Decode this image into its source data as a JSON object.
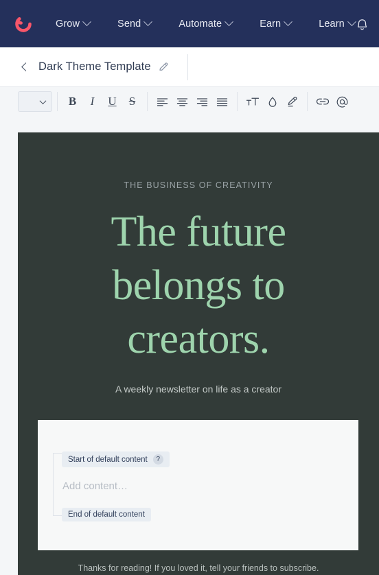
{
  "topnav": {
    "logo_name": "kit-logo",
    "logo_color": "#f8566a",
    "background": "#24305b",
    "items": [
      {
        "label": "Grow",
        "has_dropdown": true
      },
      {
        "label": "Send",
        "has_dropdown": true
      },
      {
        "label": "Automate",
        "has_dropdown": true
      },
      {
        "label": "Earn",
        "has_dropdown": true
      },
      {
        "label": "Learn",
        "has_dropdown": true
      }
    ],
    "notifications_icon": "bell-icon"
  },
  "subbar": {
    "back_icon": "chevron-left-icon",
    "title": "Dark Theme Template",
    "edit_icon": "pencil-icon"
  },
  "toolbar": {
    "block_select_icon": "chevron-down-icon",
    "buttons": [
      {
        "name": "bold-button",
        "glyph": "B",
        "style": "b"
      },
      {
        "name": "italic-button",
        "glyph": "I",
        "style": "i"
      },
      {
        "name": "underline-button",
        "glyph": "U",
        "style": "u"
      },
      {
        "name": "strikethrough-button",
        "glyph": "S",
        "style": "s"
      },
      {
        "name": "align-left-button",
        "glyph": "align-left-icon",
        "style": "svg"
      },
      {
        "name": "align-center-button",
        "glyph": "align-center-icon",
        "style": "svg"
      },
      {
        "name": "align-right-button",
        "glyph": "align-right-icon",
        "style": "svg"
      },
      {
        "name": "align-justify-button",
        "glyph": "align-justify-icon",
        "style": "svg"
      },
      {
        "name": "font-size-button",
        "glyph": "text-size-icon",
        "style": "svg"
      },
      {
        "name": "text-color-button",
        "glyph": "color-drop-icon",
        "style": "svg"
      },
      {
        "name": "highlight-button",
        "glyph": "highlighter-icon",
        "style": "svg"
      },
      {
        "name": "link-button",
        "glyph": "link-icon",
        "style": "svg"
      },
      {
        "name": "mention-button",
        "glyph": "at-mention-icon",
        "style": "svg"
      }
    ]
  },
  "email": {
    "canvas_background": "#323b38",
    "eyebrow": "THE BUSINESS OF CREATIVITY",
    "headline": "The future belongs to creators.",
    "headline_color": "#9ed4ad",
    "subhead": "A weekly newsletter on life as a creator",
    "default_content": {
      "start_label": "Start of default content",
      "help_badge": "?",
      "placeholder": "Add content…",
      "end_label": "End of default content"
    },
    "footer": "Thanks for reading! If you loved it, tell your friends to subscribe."
  }
}
